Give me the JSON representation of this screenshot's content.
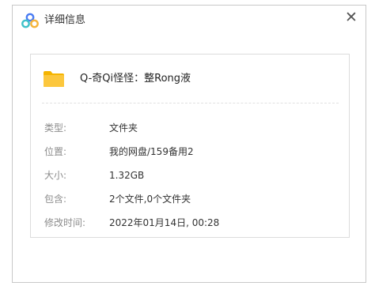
{
  "dialog": {
    "title": "详细信息",
    "close_glyph": "✕",
    "app_icon": "cloud-drive-icon",
    "app_icon_colors": [
      "#4a7cf3",
      "#3fc1c9",
      "#f5b43a"
    ],
    "close_icon": "close-icon"
  },
  "file": {
    "icon": "folder-icon",
    "icon_color": "#fcc73d",
    "name": "Q-奇Qi怪怪：整Rong液"
  },
  "details": [
    {
      "label": "类型:",
      "value": "文件夹"
    },
    {
      "label": "位置:",
      "value": "我的网盘/159备用2"
    },
    {
      "label": "大小:",
      "value": "1.32GB"
    },
    {
      "label": "包含:",
      "value": "2个文件,0个文件夹"
    },
    {
      "label": "修改时间:",
      "value": "2022年01月14日, 00:28"
    }
  ]
}
